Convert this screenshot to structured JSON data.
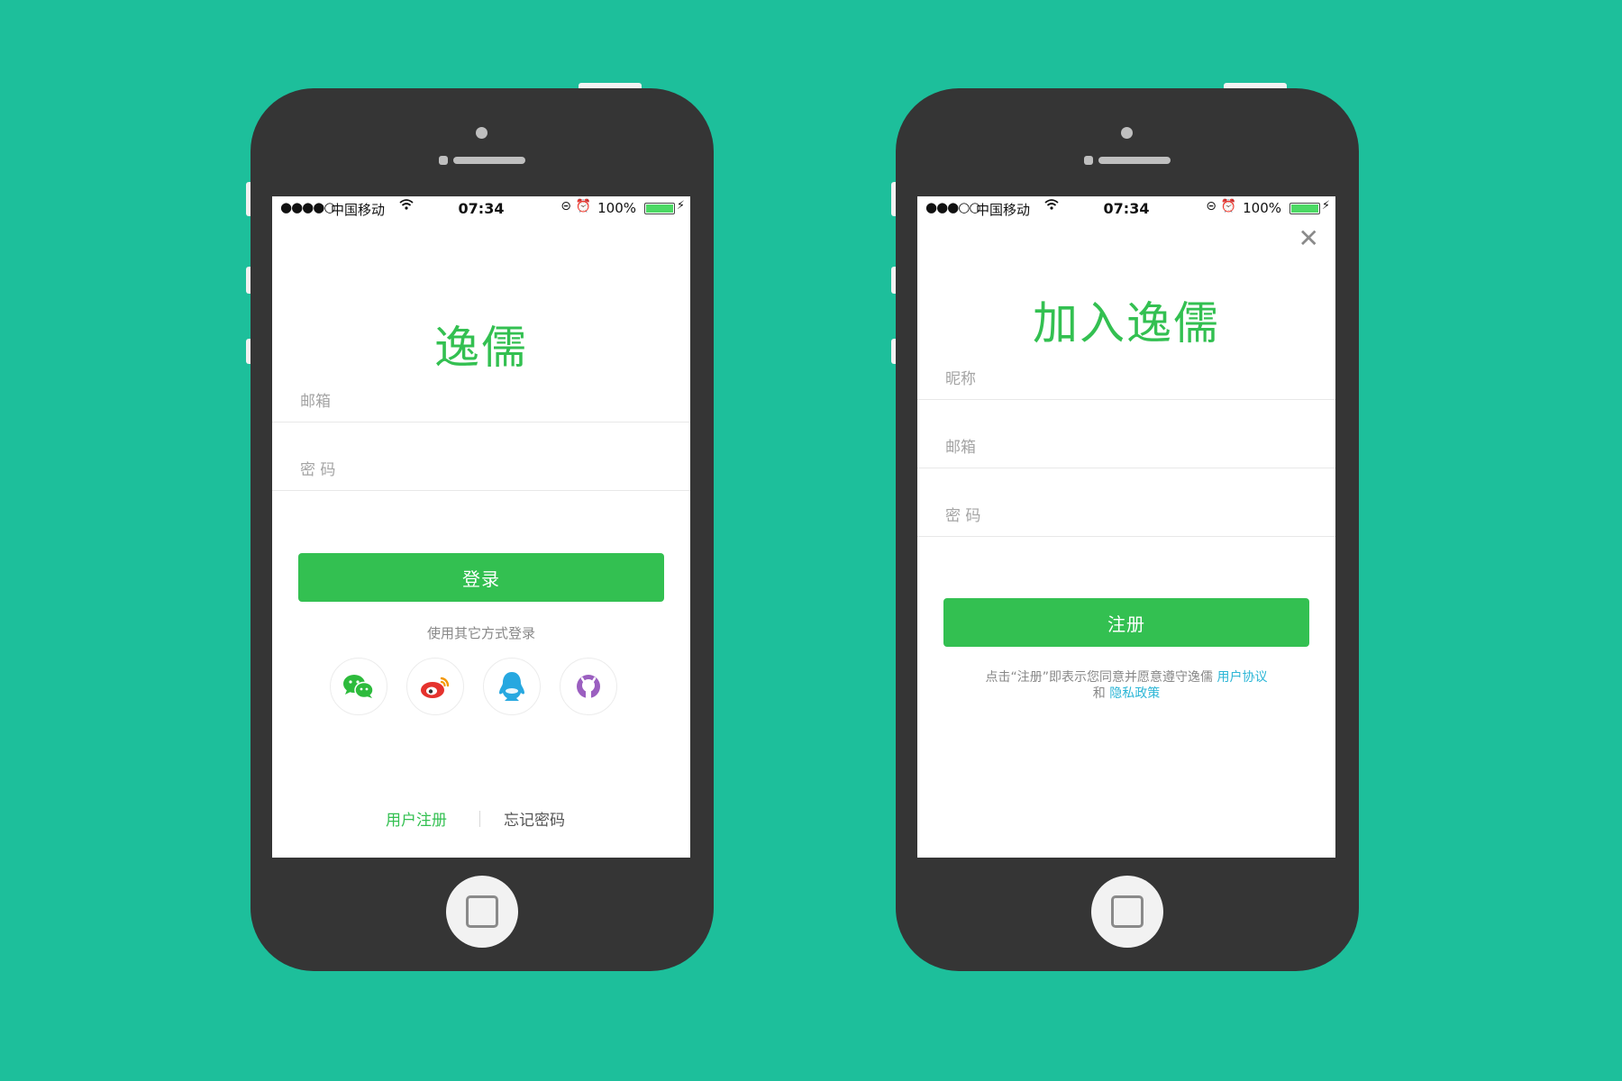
{
  "colors": {
    "background": "#1dbf9b",
    "phone_body": "#353535",
    "brand_green": "#33c051",
    "link_blue": "#2cb6d6",
    "wechat": "#2dbb3c",
    "weibo": "#e5322d",
    "qq": "#27a8e0",
    "github": "#9b5fc0"
  },
  "login_screen": {
    "status": {
      "signal": "●●●●○",
      "carrier": "中国移动",
      "wifi_icon": "wifi-icon",
      "time": "07:34",
      "battery_pct": "100%"
    },
    "title": "逸儒",
    "email_placeholder": "邮箱",
    "password_placeholder": "密 码",
    "login_button": "登录",
    "other_login_text": "使用其它方式登录",
    "social": [
      "wechat-icon",
      "weibo-icon",
      "qq-icon",
      "github-icon"
    ],
    "register_link": "用户注册",
    "forgot_link": "忘记密码"
  },
  "register_screen": {
    "status": {
      "signal": "●●●○○",
      "carrier": "中国移动",
      "wifi_icon": "wifi-icon",
      "time": "07:34",
      "battery_pct": "100%"
    },
    "close_icon": "close-icon",
    "title": "加入逸儒",
    "nickname_placeholder": "昵称",
    "email_placeholder": "邮箱",
    "password_placeholder": "密 码",
    "register_button": "注册",
    "terms_prefix": "点击“注册”即表示您同意并愿意遵守逸儒 ",
    "terms_link_agreement": "用户协议",
    "terms_and": "和 ",
    "terms_link_privacy": "隐私政策"
  }
}
